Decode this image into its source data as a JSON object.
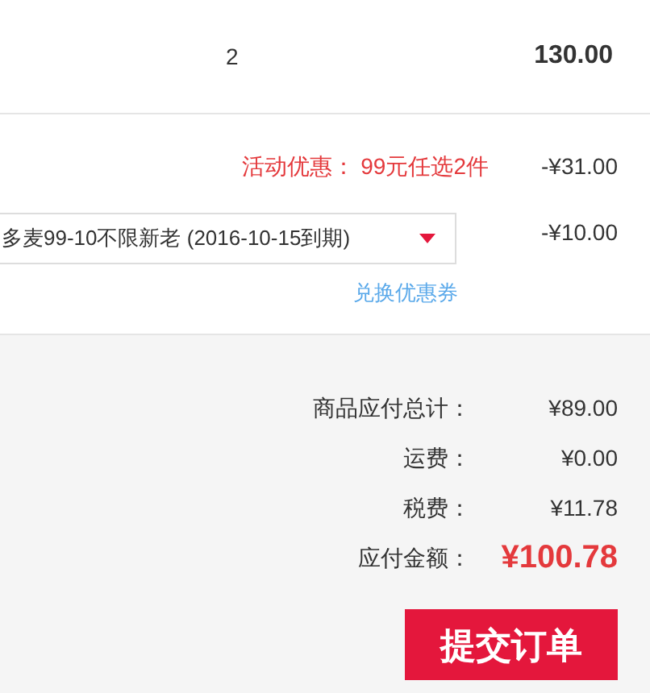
{
  "item_row": {
    "quantity": "2",
    "subtotal": "130.00"
  },
  "promotion": {
    "label": "活动优惠：",
    "name": "99元任选2件",
    "amount": "-¥31.00"
  },
  "coupon": {
    "value": "多麦99-10不限新老 (2016-10-15到期)",
    "amount": "-¥10.00",
    "redeem_link": "兑换优惠券"
  },
  "summary": [
    {
      "label": "商品应付总计：",
      "value": "¥89.00",
      "kind": "normal"
    },
    {
      "label": "运费：",
      "value": "¥0.00",
      "kind": "normal"
    },
    {
      "label": "税费：",
      "value": "¥11.78",
      "kind": "normal"
    },
    {
      "label": "应付金额：",
      "value": "¥100.78",
      "kind": "total"
    }
  ],
  "submit_button": "提交订单"
}
